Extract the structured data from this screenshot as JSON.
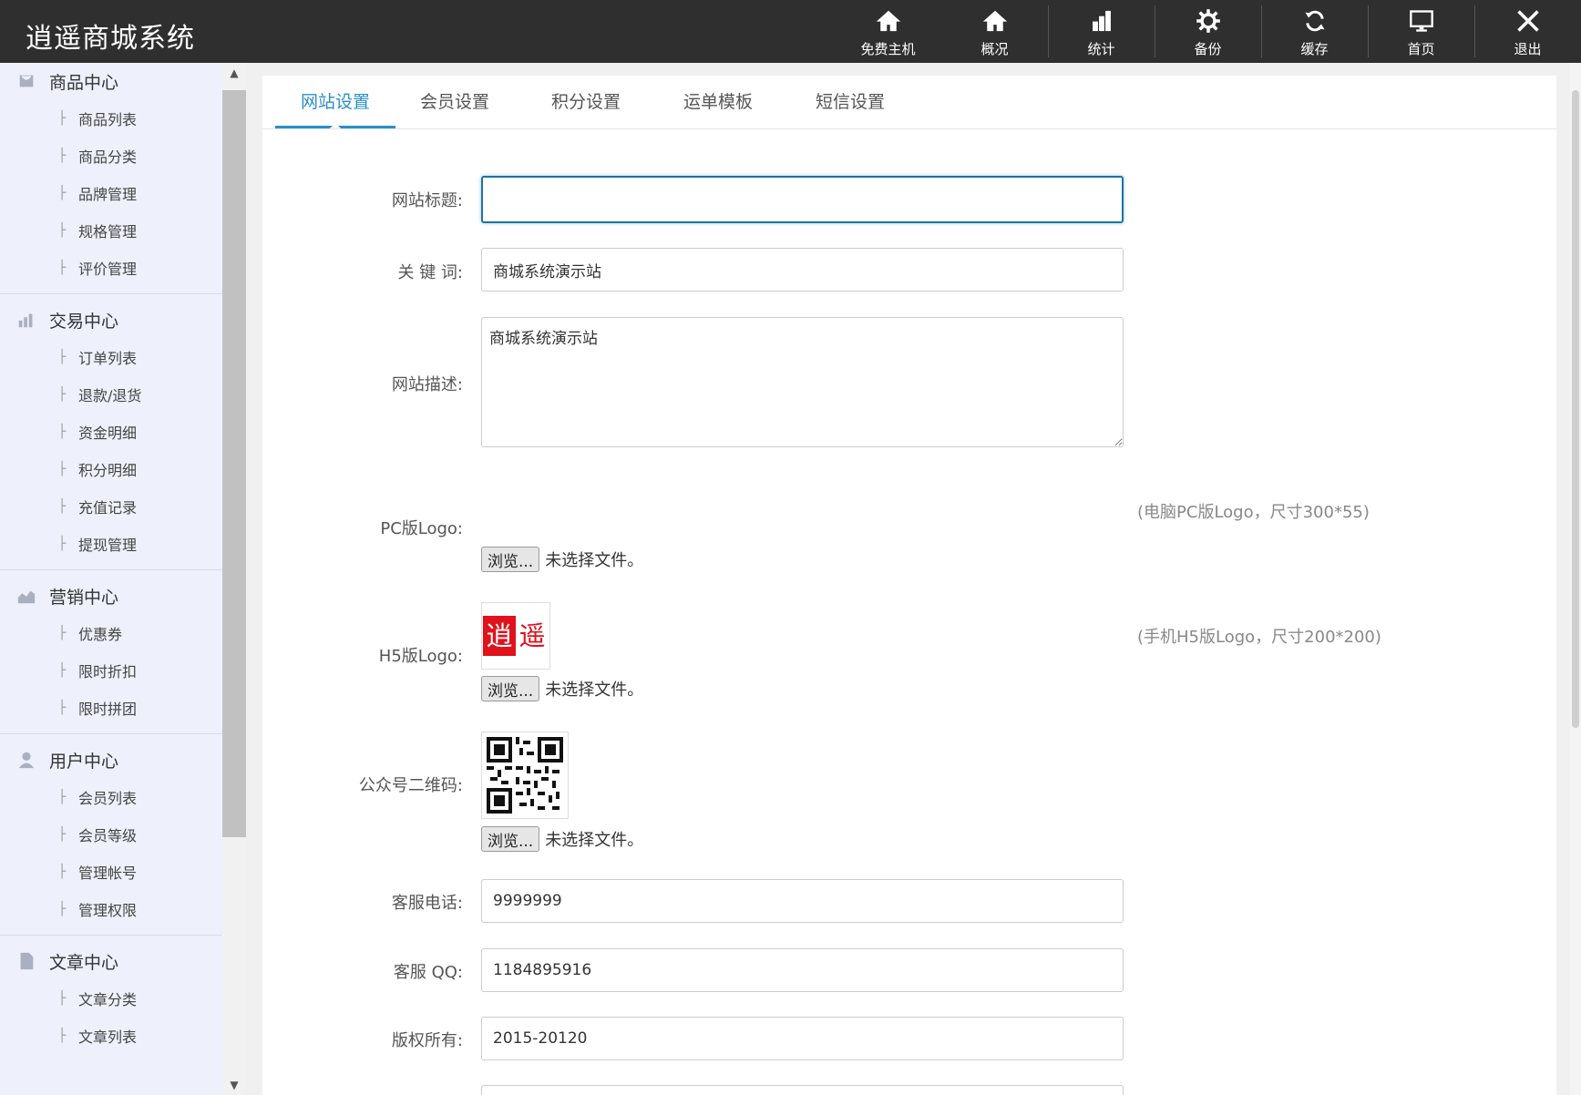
{
  "app": {
    "title": "逍遥商城系统"
  },
  "topnav": [
    {
      "label": "免费主机",
      "icon": "home-icon"
    },
    {
      "label": "概况",
      "icon": "home-icon"
    },
    {
      "label": "统计",
      "icon": "bar-chart-icon"
    },
    {
      "label": "备份",
      "icon": "gear-icon"
    },
    {
      "label": "缓存",
      "icon": "refresh-icon"
    },
    {
      "label": "首页",
      "icon": "monitor-icon"
    },
    {
      "label": "退出",
      "icon": "close-icon"
    }
  ],
  "sidebar": {
    "groups": [
      {
        "title": "商品中心",
        "icon": "bag-icon",
        "items": [
          "商品列表",
          "商品分类",
          "品牌管理",
          "规格管理",
          "评价管理"
        ]
      },
      {
        "title": "交易中心",
        "icon": "bar-chart-icon",
        "items": [
          "订单列表",
          "退款/退货",
          "资金明细",
          "积分明细",
          "充值记录",
          "提现管理"
        ]
      },
      {
        "title": "营销中心",
        "icon": "area-chart-icon",
        "items": [
          "优惠券",
          "限时折扣",
          "限时拼团"
        ]
      },
      {
        "title": "用户中心",
        "icon": "user-icon",
        "items": [
          "会员列表",
          "会员等级",
          "管理帐号",
          "管理权限"
        ]
      },
      {
        "title": "文章中心",
        "icon": "document-icon",
        "items": [
          "文章分类",
          "文章列表"
        ]
      }
    ]
  },
  "tabs": [
    "网站设置",
    "会员设置",
    "积分设置",
    "运单模板",
    "短信设置"
  ],
  "form": {
    "site_title": {
      "label": "网站标题:",
      "value": ""
    },
    "keywords": {
      "label": "关  键  词:",
      "value": "商城系统演示站"
    },
    "description": {
      "label": "网站描述:",
      "value": "商城系统演示站"
    },
    "pc_logo": {
      "label": "PC版Logo:",
      "hint": "(电脑PC版Logo，尺寸300*55)"
    },
    "h5_logo": {
      "label": "H5版Logo:",
      "hint": "(手机H5版Logo，尺寸200*200)",
      "logo_text_1": "逍",
      "logo_text_2": "遥"
    },
    "qrcode": {
      "label": "公众号二维码:"
    },
    "browse_label": "浏览...",
    "no_file": "未选择文件。",
    "phone": {
      "label": "客服电话:",
      "value": "9999999"
    },
    "qq": {
      "label": "客服 QQ:",
      "value": "1184895916"
    },
    "copyright": {
      "label": "版权所有:",
      "value": "2015-20120"
    }
  },
  "colors": {
    "topbar": "#2f2f2f",
    "accent": "#2b8fc9",
    "sidebar_bg": "#eef1fb",
    "logo_red": "#e0121b"
  }
}
